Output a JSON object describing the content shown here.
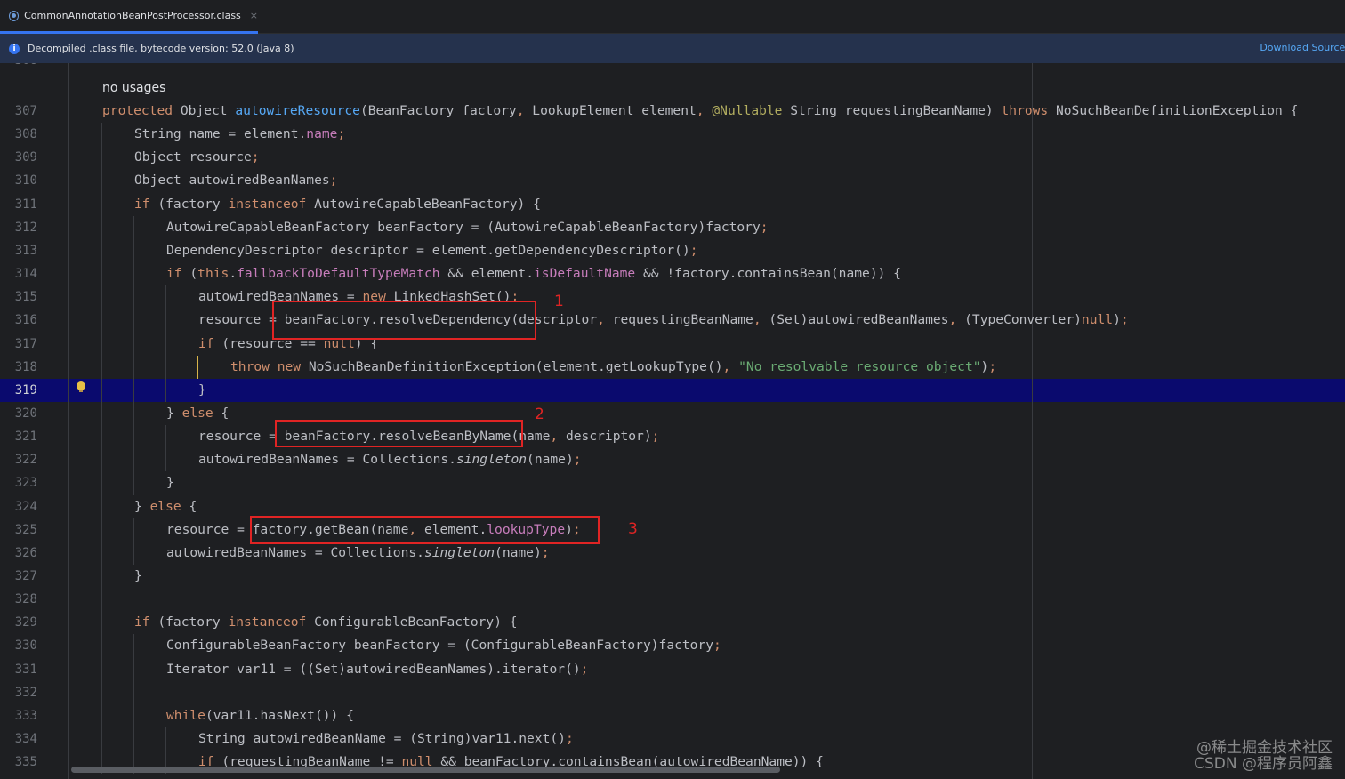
{
  "tab": {
    "label": "CommonAnnotationBeanPostProcessor.class",
    "close_glyph": "×",
    "icon": "class-file-icon"
  },
  "banner": {
    "icon": "info-icon",
    "icon_glyph": "i",
    "text": "Decompiled .class file, bytecode version: 52.0 (Java 8)",
    "action": "Download Sources"
  },
  "editor": {
    "current_line": "319",
    "first_partial_line": "306",
    "usages_hint": "no usages",
    "lines": [
      {
        "n": "307",
        "indent": 0,
        "html": "<span class='k'>protected</span> Object <span class='f'>autowireResource</span>(BeanFactory factory<span class='p'>,</span> LookupElement element<span class='p'>,</span> <span class='an'>@Nullable</span> String requestingBeanName) <span class='k'>throws</span> NoSuchBeanDefinitionException {"
      },
      {
        "n": "308",
        "indent": 1,
        "html": "String name = element.<span class='fld'>name</span><span class='p'>;</span>"
      },
      {
        "n": "309",
        "indent": 1,
        "html": "Object resource<span class='p'>;</span>"
      },
      {
        "n": "310",
        "indent": 1,
        "html": "Object autowiredBeanNames<span class='p'>;</span>"
      },
      {
        "n": "311",
        "indent": 1,
        "html": "<span class='k'>if</span> (factory <span class='k'>instanceof</span> AutowireCapableBeanFactory) {"
      },
      {
        "n": "312",
        "indent": 2,
        "html": "AutowireCapableBeanFactory beanFactory = (AutowireCapableBeanFactory)factory<span class='p'>;</span>"
      },
      {
        "n": "313",
        "indent": 2,
        "html": "DependencyDescriptor descriptor = element.getDependencyDescriptor()<span class='p'>;</span>"
      },
      {
        "n": "314",
        "indent": 2,
        "html": "<span class='k'>if</span> (<span class='k'>this</span>.<span class='fld'>fallbackToDefaultTypeMatch</span> &amp;&amp; element.<span class='fld'>isDefaultName</span> &amp;&amp; !factory.containsBean(name)) {"
      },
      {
        "n": "315",
        "indent": 3,
        "html": "autowiredBeanNames = <span class='k'>new</span> LinkedHashSet()<span class='p'>;</span>"
      },
      {
        "n": "316",
        "indent": 3,
        "html": "resource = beanFactory.resolveDependency(descriptor<span class='p'>,</span> requestingBeanName<span class='p'>,</span> (Set)autowiredBeanNames<span class='p'>,</span> (TypeConverter)<span class='k'>null</span>)<span class='p'>;</span>"
      },
      {
        "n": "317",
        "indent": 3,
        "html": "<span class='k'>if</span> (resource == <span class='k'>null</span>) {"
      },
      {
        "n": "318",
        "indent": 4,
        "html": "<span class='k'>throw new</span> NoSuchBeanDefinitionException(element.getLookupType()<span class='p'>,</span> <span class='s'>\"No resolvable resource object\"</span>)<span class='p'>;</span>"
      },
      {
        "n": "319",
        "indent": 3,
        "html": "}"
      },
      {
        "n": "320",
        "indent": 2,
        "html": "} <span class='k'>else</span> {"
      },
      {
        "n": "321",
        "indent": 3,
        "html": "resource = beanFactory.resolveBeanByName(name<span class='p'>,</span> descriptor)<span class='p'>;</span>"
      },
      {
        "n": "322",
        "indent": 3,
        "html": "autowiredBeanNames = Collections.<span class='it'>singleton</span>(name)<span class='p'>;</span>"
      },
      {
        "n": "323",
        "indent": 2,
        "html": "}"
      },
      {
        "n": "324",
        "indent": 1,
        "html": "} <span class='k'>else</span> {"
      },
      {
        "n": "325",
        "indent": 2,
        "html": "resource = factory.getBean(name<span class='p'>,</span> element.<span class='fld'>lookupType</span>)<span class='p'>;</span>"
      },
      {
        "n": "326",
        "indent": 2,
        "html": "autowiredBeanNames = Collections.<span class='it'>singleton</span>(name)<span class='p'>;</span>"
      },
      {
        "n": "327",
        "indent": 1,
        "html": "}"
      },
      {
        "n": "328",
        "indent": 0,
        "html": ""
      },
      {
        "n": "329",
        "indent": 1,
        "html": "<span class='k'>if</span> (factory <span class='k'>instanceof</span> ConfigurableBeanFactory) {"
      },
      {
        "n": "330",
        "indent": 2,
        "html": "ConfigurableBeanFactory beanFactory = (ConfigurableBeanFactory)factory<span class='p'>;</span>"
      },
      {
        "n": "331",
        "indent": 2,
        "html": "Iterator var11 = ((Set)autowiredBeanNames).iterator()<span class='p'>;</span>"
      },
      {
        "n": "332",
        "indent": 0,
        "html": ""
      },
      {
        "n": "333",
        "indent": 2,
        "html": "<span class='k'>while</span>(var11.hasNext()) {"
      },
      {
        "n": "334",
        "indent": 3,
        "html": "String autowiredBeanName = (String)var11.next()<span class='p'>;</span>"
      },
      {
        "n": "335",
        "indent": 3,
        "html": "<span class='k'>if</span> (requestingBeanName != <span class='k'>null</span> &amp;&amp; beanFactory.containsBean(autowiredBeanName)) {"
      }
    ]
  },
  "annotations": [
    {
      "label": "1"
    },
    {
      "label": "2"
    },
    {
      "label": "3"
    }
  ],
  "watermark": {
    "line1": "@稀土掘金技术社区",
    "line2": "CSDN @程序员阿鑫"
  }
}
